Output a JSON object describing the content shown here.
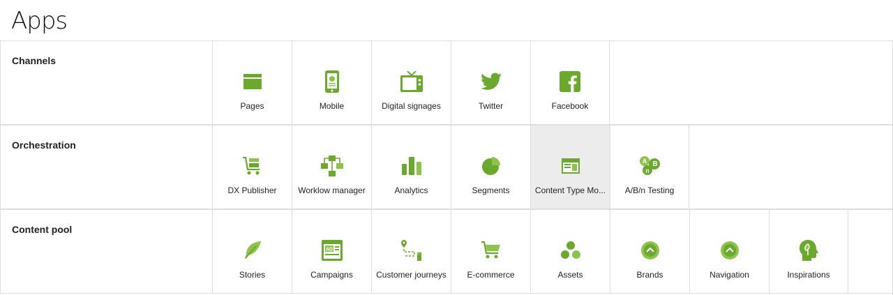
{
  "page": {
    "title": "Apps"
  },
  "colors": {
    "accent": "#6aa82e",
    "accent_light": "#8cc34a",
    "selected_bg": "#ececec",
    "border": "#dddddd"
  },
  "sections": [
    {
      "label": "Channels",
      "tiles": [
        {
          "label": "Pages",
          "icon": "pages-icon"
        },
        {
          "label": "Mobile",
          "icon": "mobile-icon"
        },
        {
          "label": "Digital signages",
          "icon": "tv-icon"
        },
        {
          "label": "Twitter",
          "icon": "twitter-icon"
        },
        {
          "label": "Facebook",
          "icon": "facebook-icon"
        }
      ]
    },
    {
      "label": "Orchestration",
      "tiles": [
        {
          "label": "DX Publisher",
          "icon": "cart-publisher-icon"
        },
        {
          "label": "Worklow manager",
          "icon": "workflow-icon"
        },
        {
          "label": "Analytics",
          "icon": "bar-chart-icon"
        },
        {
          "label": "Segments",
          "icon": "pie-chart-icon"
        },
        {
          "label": "Content Type Mo...",
          "icon": "content-type-icon",
          "selected": true
        },
        {
          "label": "A/B/n Testing",
          "icon": "abn-testing-icon"
        }
      ]
    },
    {
      "label": "Content pool",
      "tiles": [
        {
          "label": "Stories",
          "icon": "feather-icon"
        },
        {
          "label": "Campaigns",
          "icon": "ad-icon"
        },
        {
          "label": "Customer journeys",
          "icon": "journey-icon"
        },
        {
          "label": "E-commerce",
          "icon": "shopping-cart-icon"
        },
        {
          "label": "Assets",
          "icon": "assets-icon"
        },
        {
          "label": "Brands",
          "icon": "brands-icon"
        },
        {
          "label": "Navigation",
          "icon": "navigation-icon"
        },
        {
          "label": "Inspirations",
          "icon": "head-leaf-icon"
        }
      ]
    }
  ]
}
